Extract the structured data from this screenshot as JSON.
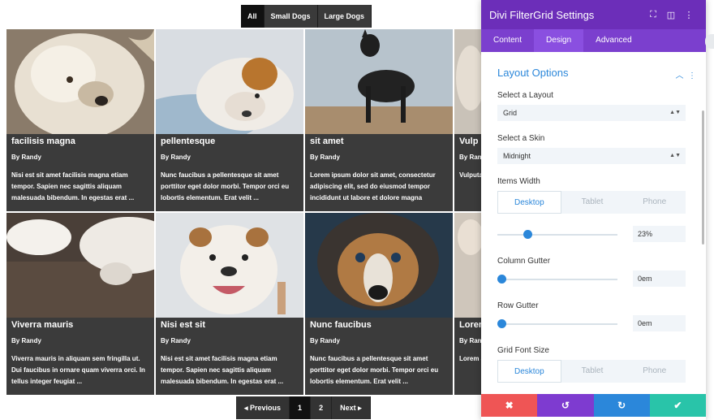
{
  "filters": [
    "All",
    "Small Dogs",
    "Large Dogs"
  ],
  "cards": [
    {
      "title": "facilisis magna",
      "author": "By Randy",
      "excerpt": "Nisi est sit amet facilisis magna etiam tempor. Sapien nec sagittis aliquam malesuada bibendum. In egestas erat ..."
    },
    {
      "title": "pellentesque",
      "author": "By Randy",
      "excerpt": "Nunc faucibus a pellentesque sit amet porttitor eget dolor morbi. Tempor orci eu lobortis elementum. Erat velit ..."
    },
    {
      "title": "sit amet",
      "author": "By Randy",
      "excerpt": "Lorem ipsum dolor sit amet, consectetur adipiscing elit, sed do eiusmod tempor incididunt ut labore et dolore magna"
    },
    {
      "title": "Vulp",
      "author": "By Ran",
      "excerpt": "Vulputa proin fe non arc"
    },
    {
      "title": "Viverra mauris",
      "author": "By Randy",
      "excerpt": "Viverra mauris in aliquam sem fringilla ut. Dui faucibus in ornare quam viverra orci. In tellus integer feugiat ..."
    },
    {
      "title": "Nisi est sit",
      "author": "By Randy",
      "excerpt": "Nisi est sit amet facilisis magna etiam tempor. Sapien nec sagittis aliquam malesuada bibendum. In egestas erat ..."
    },
    {
      "title": "Nunc faucibus",
      "author": "By Randy",
      "excerpt": "Nunc faucibus a pellentesque sit amet porttitor eget dolor morbi. Tempor orci eu lobortis elementum. Erat velit ..."
    },
    {
      "title": "Lorem",
      "author": "By Ran",
      "excerpt": "Lorem adipisc incididu"
    }
  ],
  "pagination": {
    "prev": "◂ Previous",
    "pages": [
      "1",
      "2"
    ],
    "next": "Next ▸"
  },
  "panel": {
    "title": "Divi FilterGrid Settings",
    "tabs": [
      "Content",
      "Design",
      "Advanced"
    ],
    "section": "Layout Options",
    "layout_label": "Select a Layout",
    "layout_value": "Grid",
    "skin_label": "Select a Skin",
    "skin_value": "Midnight",
    "items_width_label": "Items Width",
    "devices": [
      "Desktop",
      "Tablet",
      "Phone"
    ],
    "items_width_value": "23%",
    "items_width_fraction": 0.25,
    "column_gutter_label": "Column Gutter",
    "column_gutter_value": "0em",
    "row_gutter_label": "Row Gutter",
    "row_gutter_value": "0em",
    "font_size_label": "Grid Font Size"
  },
  "actions": {
    "cancel": "✖",
    "undo": "↺",
    "redo": "↻",
    "save": "✔"
  },
  "colors": {
    "header": "#6c2eb9",
    "accent": "#2b87da",
    "cancel": "#ef5555",
    "undo": "#7e3bd0",
    "redo": "#2b87da",
    "save": "#29c4a9"
  }
}
